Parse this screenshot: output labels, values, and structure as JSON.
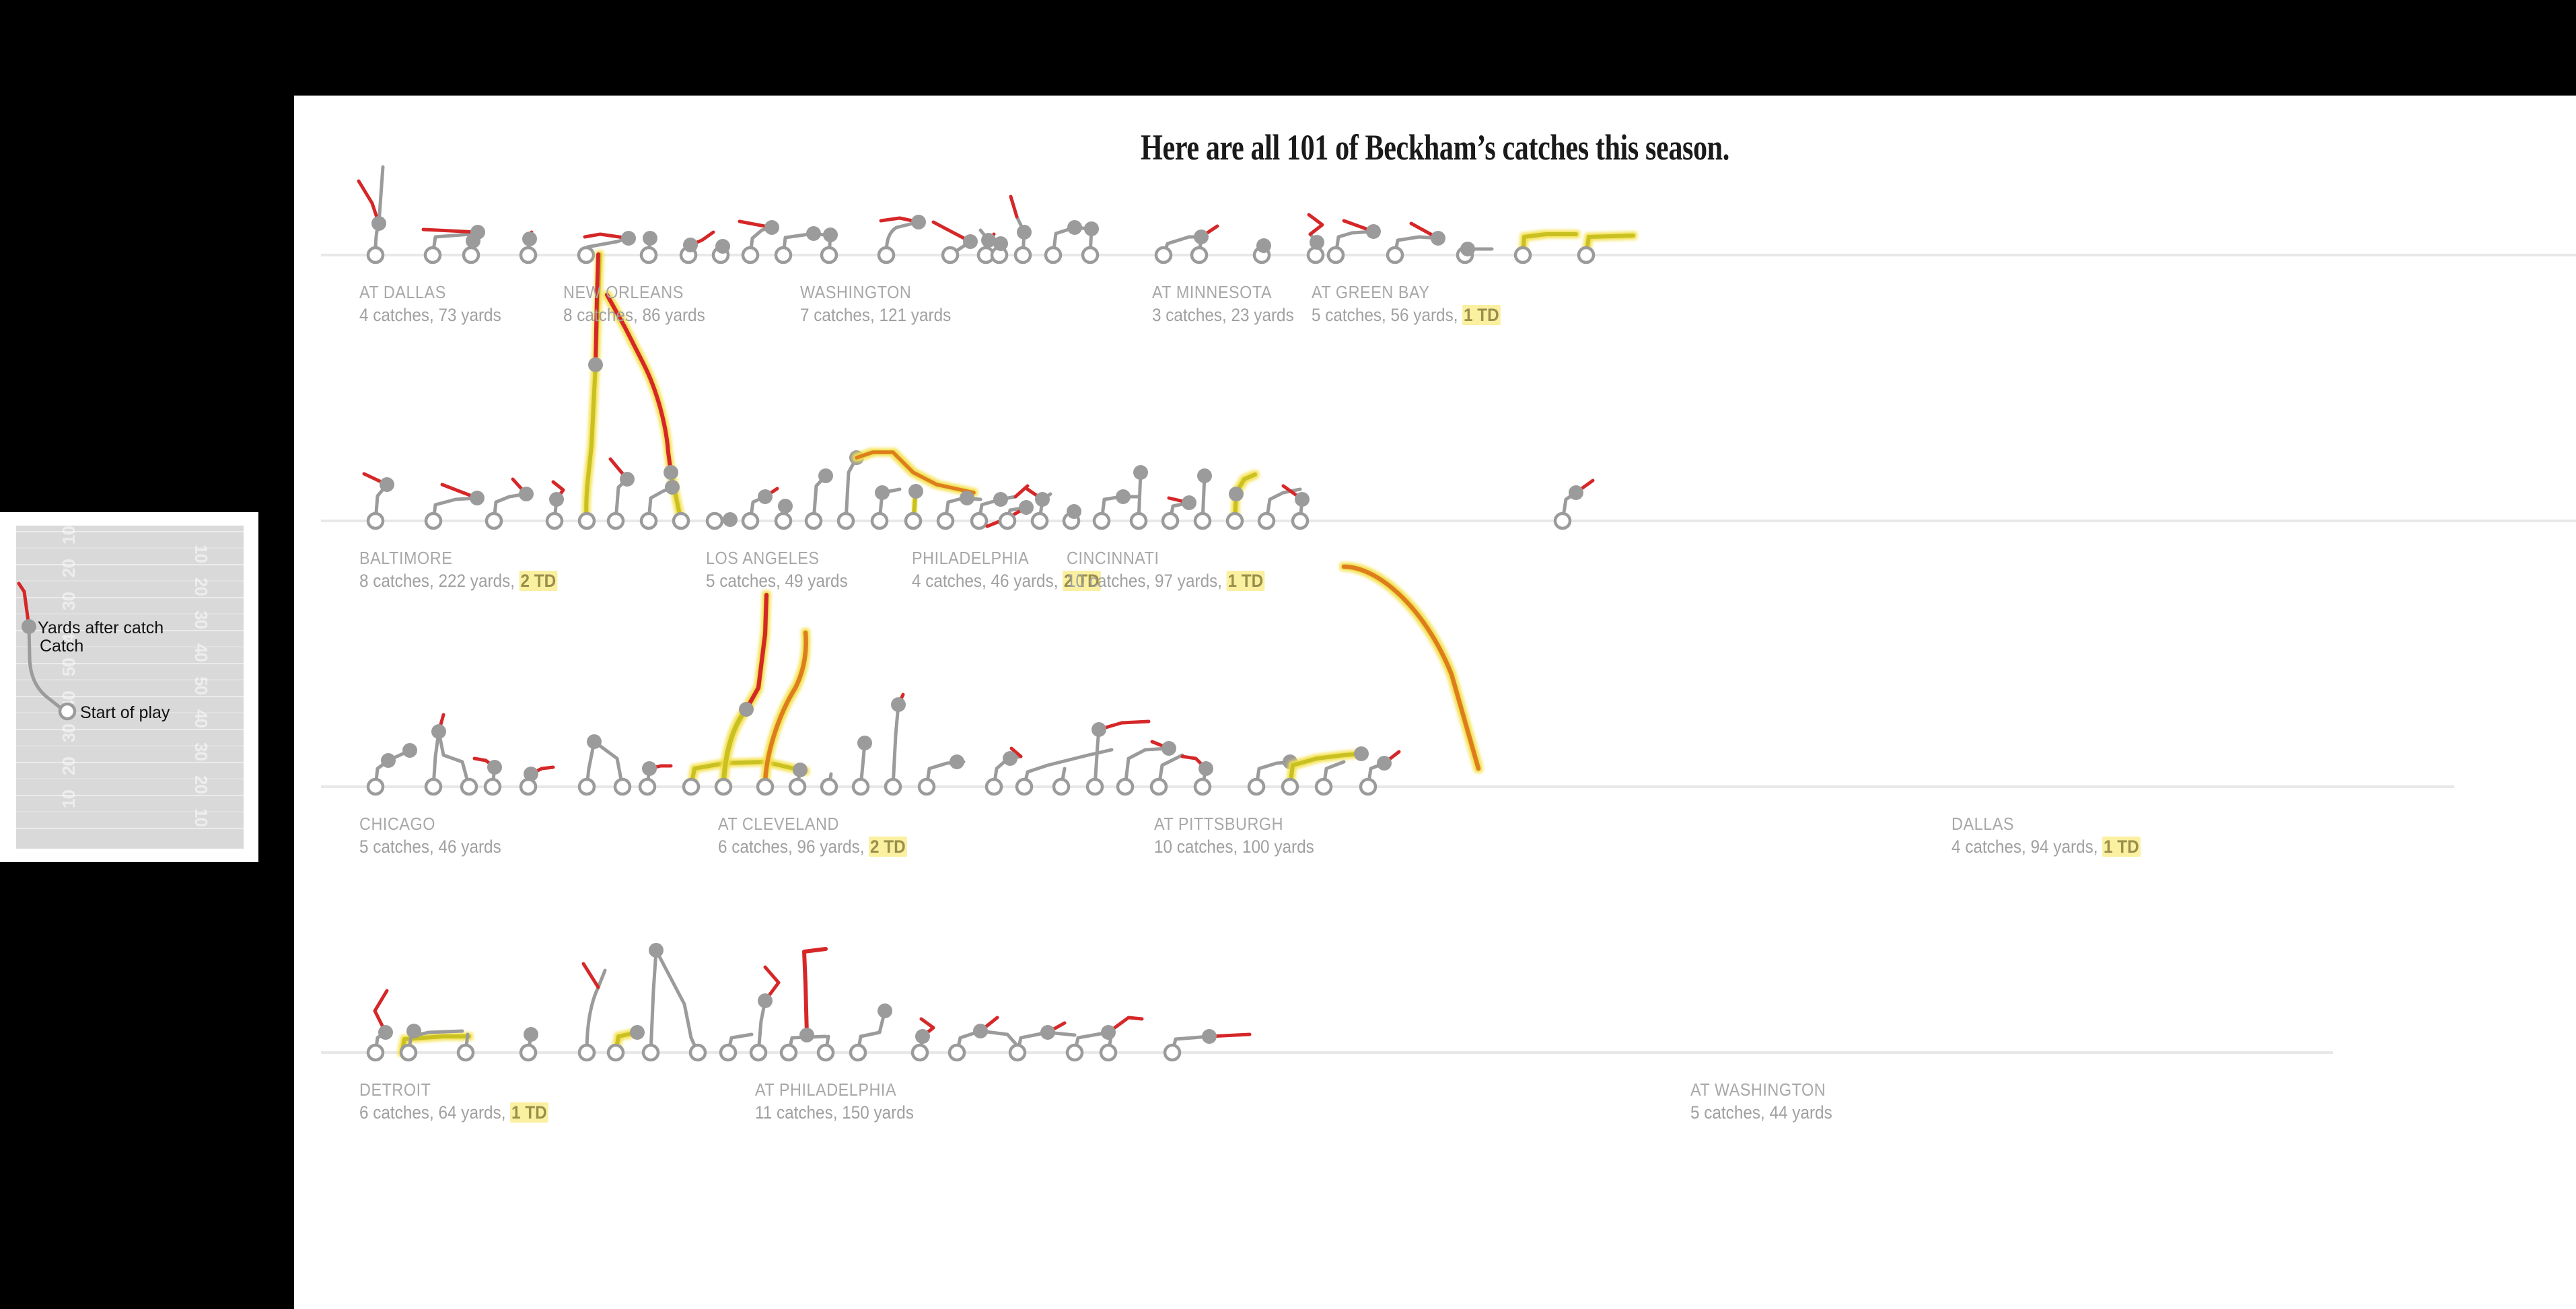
{
  "headline": "Here are all 101 of Beckham’s catches this season.",
  "legend": {
    "yards_after_catch": "Yards after catch",
    "catch": "Catch",
    "start_of_play": "Start of play",
    "field_numbers_left": [
      "10",
      "20",
      "30",
      "40",
      "50",
      "40",
      "30",
      "20",
      "10"
    ],
    "field_numbers_right": [
      "10",
      "20",
      "30",
      "40",
      "50",
      "40",
      "30",
      "20",
      "10"
    ]
  },
  "colors": {
    "yac_line": "#d62728",
    "route_line": "#9b9b9b",
    "catch_dot": "#9b9b9b",
    "start_dot_fill": "#ffffff",
    "start_dot_stroke": "#9b9b9b",
    "touchdown_glow": "#f5e14f",
    "baseline": "#e8e8e8",
    "label_text": "#a8a8a8",
    "td_badge_bg": "#faf0a0",
    "panel_bg": "#ffffff",
    "page_bg": "#000000"
  },
  "chart_data": {
    "type": "line",
    "title": "Here are all 101 of Beckham’s catches this season.",
    "xlabel": "",
    "ylabel": "",
    "description": "Small-multiple route charts: one panel per game. Each catch is drawn as a gray route line from an open circle (start of play) to a filled gray dot (the catch), then a red segment for yards after catch. Touchdown plays carry a yellow glow.",
    "total_catches": 101,
    "games": [
      {
        "name": "AT DALLAS",
        "catches": 4,
        "yards": 73,
        "td": 0,
        "stat": "4 catches, 73 yards",
        "row": 1
      },
      {
        "name": "NEW ORLEANS",
        "catches": 8,
        "yards": 86,
        "td": 0,
        "stat": "8 catches, 86 yards",
        "row": 1
      },
      {
        "name": "WASHINGTON",
        "catches": 7,
        "yards": 121,
        "td": 0,
        "stat": "7 catches, 121 yards",
        "row": 1
      },
      {
        "name": "AT MINNESOTA",
        "catches": 3,
        "yards": 23,
        "td": 0,
        "stat": "3 catches, 23 yards",
        "row": 1
      },
      {
        "name": "AT GREEN BAY",
        "catches": 5,
        "yards": 56,
        "td": 1,
        "stat": "5 catches, 56 yards, ",
        "td_label": "1 TD",
        "row": 1
      },
      {
        "name": "BALTIMORE",
        "catches": 8,
        "yards": 222,
        "td": 2,
        "stat": "8 catches, 222 yards, ",
        "td_label": "2 TD",
        "row": 2
      },
      {
        "name": "LOS ANGELES",
        "catches": 5,
        "yards": 49,
        "td": 0,
        "stat": "5 catches, 49 yards",
        "row": 2
      },
      {
        "name": "PHILADELPHIA",
        "catches": 4,
        "yards": 46,
        "td": 2,
        "stat": "4 catches, 46 yards, ",
        "td_label": "2 TD",
        "row": 2
      },
      {
        "name": "CINCINNATI",
        "catches": 10,
        "yards": 97,
        "td": 1,
        "stat": "10 catches, 97 yards, ",
        "td_label": "1 TD",
        "row": 2
      },
      {
        "name": "CHICAGO",
        "catches": 5,
        "yards": 46,
        "td": 0,
        "stat": "5 catches, 46 yards",
        "row": 3
      },
      {
        "name": "AT CLEVELAND",
        "catches": 6,
        "yards": 96,
        "td": 2,
        "stat": "6 catches, 96 yards, ",
        "td_label": "2 TD",
        "row": 3
      },
      {
        "name": "AT PITTSBURGH",
        "catches": 10,
        "yards": 100,
        "td": 0,
        "stat": "10 catches, 100 yards",
        "row": 3
      },
      {
        "name": "DALLAS",
        "catches": 4,
        "yards": 94,
        "td": 1,
        "stat": "4 catches, 94 yards, ",
        "td_label": "1 TD",
        "row": 3
      },
      {
        "name": "DETROIT",
        "catches": 6,
        "yards": 64,
        "td": 1,
        "stat": "6 catches, 64 yards, ",
        "td_label": "1 TD",
        "row": 4
      },
      {
        "name": "AT PHILADELPHIA",
        "catches": 11,
        "yards": 150,
        "td": 0,
        "stat": "11 catches, 150 yards",
        "row": 4
      },
      {
        "name": "AT WASHINGTON",
        "catches": 5,
        "yards": 44,
        "td": 0,
        "stat": "5 catches, 44 yards",
        "row": 4
      }
    ]
  }
}
